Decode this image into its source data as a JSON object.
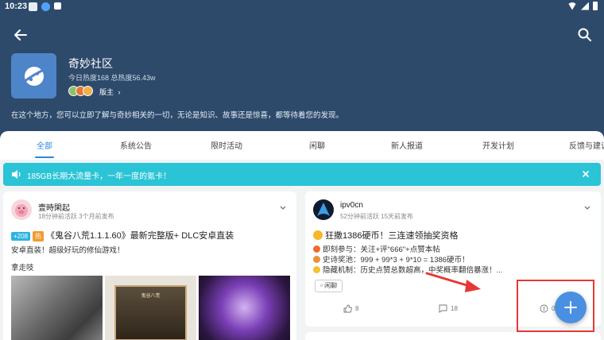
{
  "statusbar": {
    "time": "10:23"
  },
  "community": {
    "name": "奇妙社区",
    "heat": "今日热度168 总热度56.43w",
    "admin_label": "版主",
    "description": "在这个地方，您可以立即了解与奇妙相关的一切，无论是知识、故事还是惊喜，都等待着您的发现。"
  },
  "tabs": [
    "全部",
    "系统公告",
    "限时活动",
    "闲聊",
    "新人报道",
    "开发计划",
    "反馈与建议"
  ],
  "announcement": {
    "text": "185GB长期大流量卡，一年一度的氪卡！"
  },
  "post1": {
    "author": "壹時閑起",
    "meta": "18分钟前活跃  3个月前发布",
    "badge_count": "+208",
    "badge_hot": "热",
    "title": "《鬼谷八荒1.1.1.60》最新完整版+ DLC安卓直装",
    "subtitle": "安卓直装！超级好玩的修仙游戏！",
    "body": "拿走吱",
    "thumb2_label": "鬼谷八荒"
  },
  "post2": {
    "author": "ipv0cn",
    "meta": "52分钟前活跃  15天前发布",
    "title": "狂撒1386硬币！三连速领抽奖资格",
    "lines": [
      "即刻参与：关注+评\"666\"+点赞本帖",
      "史诗奖池：999 + 99*3 + 9*10 = 1386硬币！",
      "隐藏机制：历史点赞总数超高，中奖概率翻倍暴涨！..."
    ],
    "tag": "闲聊",
    "likes": "8",
    "comments": "18",
    "coins": "0"
  },
  "colors": {
    "header_bg": "#2d4a6b",
    "accent": "#2b87e0",
    "announce_bg": "#2bc4d6",
    "fab": "#4a90e2",
    "highlight": "#e53935"
  }
}
